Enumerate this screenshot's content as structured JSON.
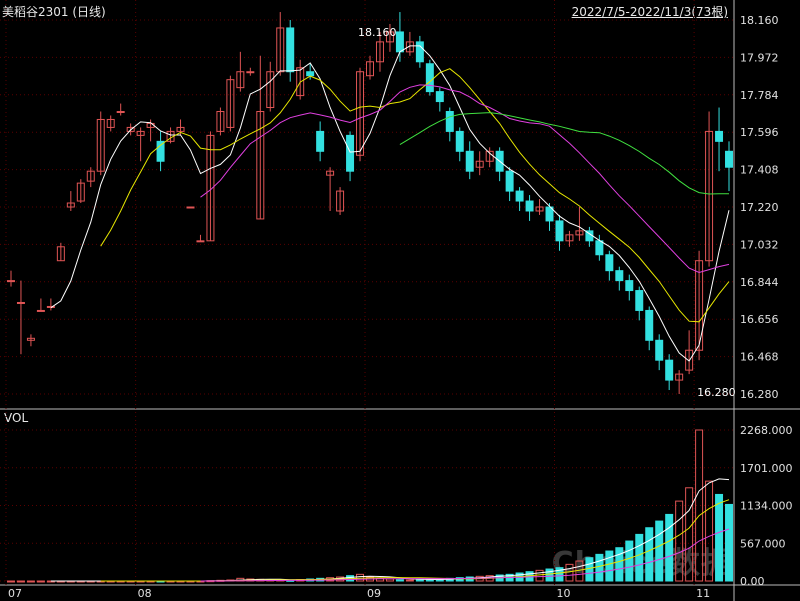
{
  "header": {
    "title": "美稻谷2301 (日线)",
    "range": "2022/7/5-2022/11/3(73根)"
  },
  "volume_panel": {
    "label": "VOL"
  },
  "watermark": "Choice数据",
  "colors": {
    "up": "#e05555",
    "down": "#33e0e0",
    "ma5": "#ffffff",
    "ma10": "#e6e600",
    "ma20": "#e040e0",
    "ma40": "#40e040",
    "grid": "#5a0000",
    "axis": "#bbbbbb"
  },
  "chart_data": [
    {
      "type": "candlestick",
      "price_ticks": [
        "18.160",
        "17.972",
        "17.784",
        "17.596",
        "17.408",
        "17.220",
        "17.032",
        "16.844",
        "16.656",
        "16.468",
        "16.280"
      ],
      "month_labels": [
        {
          "label": "07",
          "index": 0
        },
        {
          "label": "08",
          "index": 13
        },
        {
          "label": "09",
          "index": 36
        },
        {
          "label": "10",
          "index": 55
        },
        {
          "label": "11",
          "index": 69
        }
      ],
      "annotations": [
        {
          "text": "18.160",
          "index": 34,
          "value": 18.16
        },
        {
          "text": "16.280",
          "index": 68,
          "value": 16.28
        }
      ],
      "ylim": [
        16.28,
        18.16
      ],
      "candles": [
        [
          16.85,
          16.85,
          16.9,
          16.82
        ],
        [
          16.74,
          16.74,
          16.85,
          16.48
        ],
        [
          16.55,
          16.56,
          16.58,
          16.52
        ],
        [
          16.7,
          16.7,
          16.76,
          16.7
        ],
        [
          16.72,
          16.72,
          16.76,
          16.7
        ],
        [
          16.95,
          17.02,
          17.04,
          16.95
        ],
        [
          17.22,
          17.24,
          17.3,
          17.2
        ],
        [
          17.25,
          17.34,
          17.36,
          17.24
        ],
        [
          17.35,
          17.4,
          17.42,
          17.32
        ],
        [
          17.4,
          17.66,
          17.7,
          17.38
        ],
        [
          17.62,
          17.66,
          17.68,
          17.6
        ],
        [
          17.7,
          17.7,
          17.74,
          17.68
        ],
        [
          17.6,
          17.62,
          17.64,
          17.58
        ],
        [
          17.58,
          17.6,
          17.62,
          17.45
        ],
        [
          17.62,
          17.64,
          17.66,
          17.55
        ],
        [
          17.55,
          17.45,
          17.6,
          17.4
        ],
        [
          17.55,
          17.6,
          17.62,
          17.54
        ],
        [
          17.6,
          17.62,
          17.66,
          17.58
        ],
        [
          17.22,
          17.22,
          17.22,
          17.22
        ],
        [
          17.05,
          17.05,
          17.08,
          17.05
        ],
        [
          17.05,
          17.58,
          17.6,
          17.05
        ],
        [
          17.6,
          17.7,
          17.72,
          17.58
        ],
        [
          17.62,
          17.86,
          17.88,
          17.6
        ],
        [
          17.82,
          17.9,
          18.0,
          17.8
        ],
        [
          17.9,
          17.9,
          17.92,
          17.88
        ],
        [
          17.16,
          17.7,
          17.98,
          17.16
        ],
        [
          17.72,
          17.9,
          17.95,
          17.7
        ],
        [
          17.9,
          18.12,
          18.2,
          17.88
        ],
        [
          18.12,
          17.9,
          18.16,
          17.85
        ],
        [
          17.78,
          17.92,
          17.96,
          17.76
        ],
        [
          17.9,
          17.88,
          17.94,
          17.86
        ],
        [
          17.6,
          17.5,
          17.65,
          17.45
        ],
        [
          17.38,
          17.4,
          17.42,
          17.2
        ],
        [
          17.2,
          17.3,
          17.32,
          17.18
        ],
        [
          17.58,
          17.4,
          17.6,
          17.35
        ],
        [
          17.48,
          17.9,
          17.92,
          17.45
        ],
        [
          17.88,
          17.95,
          17.98,
          17.86
        ],
        [
          17.95,
          18.05,
          18.1,
          17.9
        ],
        [
          18.05,
          18.1,
          18.14,
          18.0
        ],
        [
          18.1,
          18.0,
          18.2,
          17.95
        ],
        [
          18.0,
          18.05,
          18.1,
          17.98
        ],
        [
          18.05,
          17.95,
          18.08,
          17.92
        ],
        [
          17.94,
          17.8,
          17.96,
          17.78
        ],
        [
          17.8,
          17.75,
          17.82,
          17.7
        ],
        [
          17.7,
          17.6,
          17.72,
          17.55
        ],
        [
          17.6,
          17.5,
          17.62,
          17.45
        ],
        [
          17.5,
          17.4,
          17.55,
          17.36
        ],
        [
          17.42,
          17.45,
          17.5,
          17.38
        ],
        [
          17.45,
          17.5,
          17.52,
          17.42
        ],
        [
          17.5,
          17.4,
          17.52,
          17.35
        ],
        [
          17.4,
          17.3,
          17.42,
          17.25
        ],
        [
          17.3,
          17.25,
          17.32,
          17.2
        ],
        [
          17.25,
          17.2,
          17.28,
          17.15
        ],
        [
          17.2,
          17.22,
          17.26,
          17.18
        ],
        [
          17.22,
          17.15,
          17.24,
          17.1
        ],
        [
          17.15,
          17.05,
          17.18,
          17.0
        ],
        [
          17.05,
          17.08,
          17.1,
          17.02
        ],
        [
          17.08,
          17.1,
          17.22,
          17.05
        ],
        [
          17.1,
          17.05,
          17.12,
          17.02
        ],
        [
          17.05,
          16.98,
          17.08,
          16.95
        ],
        [
          16.98,
          16.9,
          17.0,
          16.85
        ],
        [
          16.9,
          16.85,
          16.92,
          16.8
        ],
        [
          16.85,
          16.8,
          16.88,
          16.75
        ],
        [
          16.8,
          16.7,
          16.82,
          16.65
        ],
        [
          16.7,
          16.55,
          16.72,
          16.5
        ],
        [
          16.55,
          16.45,
          16.58,
          16.4
        ],
        [
          16.45,
          16.35,
          16.48,
          16.3
        ],
        [
          16.35,
          16.38,
          16.4,
          16.28
        ],
        [
          16.4,
          16.5,
          16.6,
          16.38
        ],
        [
          16.5,
          16.95,
          17.0,
          16.45
        ],
        [
          16.95,
          17.6,
          17.7,
          16.92
        ],
        [
          17.6,
          17.55,
          17.72,
          17.4
        ],
        [
          17.5,
          17.42,
          17.55,
          17.3
        ]
      ]
    },
    {
      "type": "bar",
      "title": "VOL",
      "ticks": [
        "2268.000",
        "1701.000",
        "1134.000",
        "567.000",
        "0.00"
      ],
      "ylim": [
        0,
        2268
      ],
      "values": [
        0,
        0,
        0,
        0,
        0,
        0,
        0,
        0,
        0,
        0,
        0,
        0,
        0,
        0,
        0,
        0,
        0,
        0,
        0,
        0,
        5,
        10,
        15,
        40,
        30,
        25,
        20,
        15,
        10,
        20,
        30,
        40,
        50,
        60,
        80,
        100,
        60,
        40,
        30,
        20,
        15,
        25,
        20,
        30,
        40,
        50,
        60,
        70,
        80,
        90,
        100,
        120,
        140,
        160,
        180,
        200,
        250,
        300,
        350,
        400,
        450,
        500,
        600,
        700,
        800,
        900,
        1000,
        1200,
        1400,
        2268,
        1500,
        1300,
        1150
      ]
    }
  ]
}
